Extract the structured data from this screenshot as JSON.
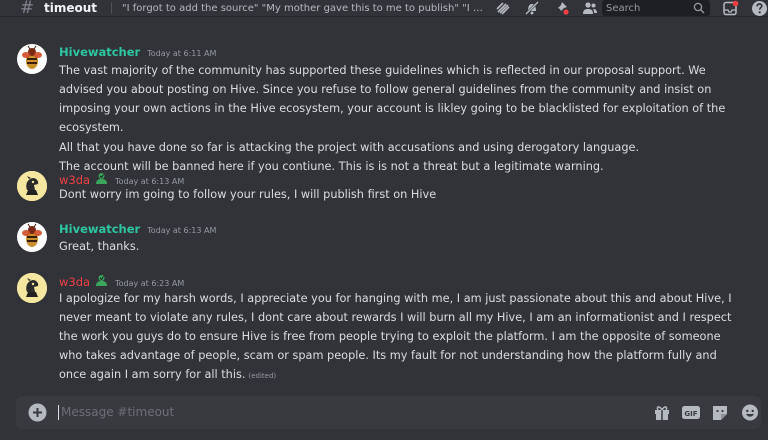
{
  "header": {
    "channel_hash": "#",
    "channel_name": "timeout",
    "topic": "\"I forgot to add the source\" \"My mother gave this to me to publish\" \"I am human\"...",
    "search_placeholder": "Search",
    "icons": [
      "threads-icon",
      "mute-icon",
      "pin-icon",
      "members-icon",
      "search-icon",
      "inbox-icon",
      "help-icon"
    ]
  },
  "messages": [
    {
      "author": "Hivewatcher",
      "timestamp": "Today at 6:11 AM",
      "paragraphs": [
        "The vast majority of the community has supported these guidelines which is reflected in our proposal support.  We advised you about posting on Hive. Since you refuse to follow general guidelines from the community and insist on imposing your own actions in the Hive ecosystem, your account is likley going to be blacklisted for exploitation of the ecosystem.",
        "All that you have done so far is attacking the project with accusations and using derogatory language.",
        "The account will be banned here if you contiune. This is is not a threat but a legitimate warning."
      ]
    },
    {
      "author": "w3da",
      "timestamp": "Today at 6:13 AM",
      "text": "Dont worry im going to follow your rules, I will publish first on Hive"
    },
    {
      "author": "Hivewatcher",
      "timestamp": "Today at 6:13 AM",
      "text": "Great, thanks."
    },
    {
      "author": "w3da",
      "timestamp": "Today at 6:23 AM",
      "text": "I apologize for my harsh words, I appreciate you for hanging with me, I am just passionate about this and about Hive, I never meant to violate any rules, I dont care about rewards I will burn all my Hive, I am an informationist and I respect the work you guys do to ensure Hive is free from people trying to exploit the platform. I am the opposite of someone who takes advantage of people, scam or spam people. Its my fault for not understanding how the platform fully and once again I am sorry for all this.",
      "edited": "(edited)"
    }
  ],
  "composer": {
    "placeholder": "Message #timeout",
    "icons": [
      "add-icon",
      "gift-icon",
      "gif-icon",
      "sticker-icon",
      "emoji-icon"
    ]
  },
  "colors": {
    "background": "#313338",
    "hivewatcher_name": "#2dc6a2",
    "w3da_name": "#f23f43",
    "composer_bg": "#383a40"
  }
}
